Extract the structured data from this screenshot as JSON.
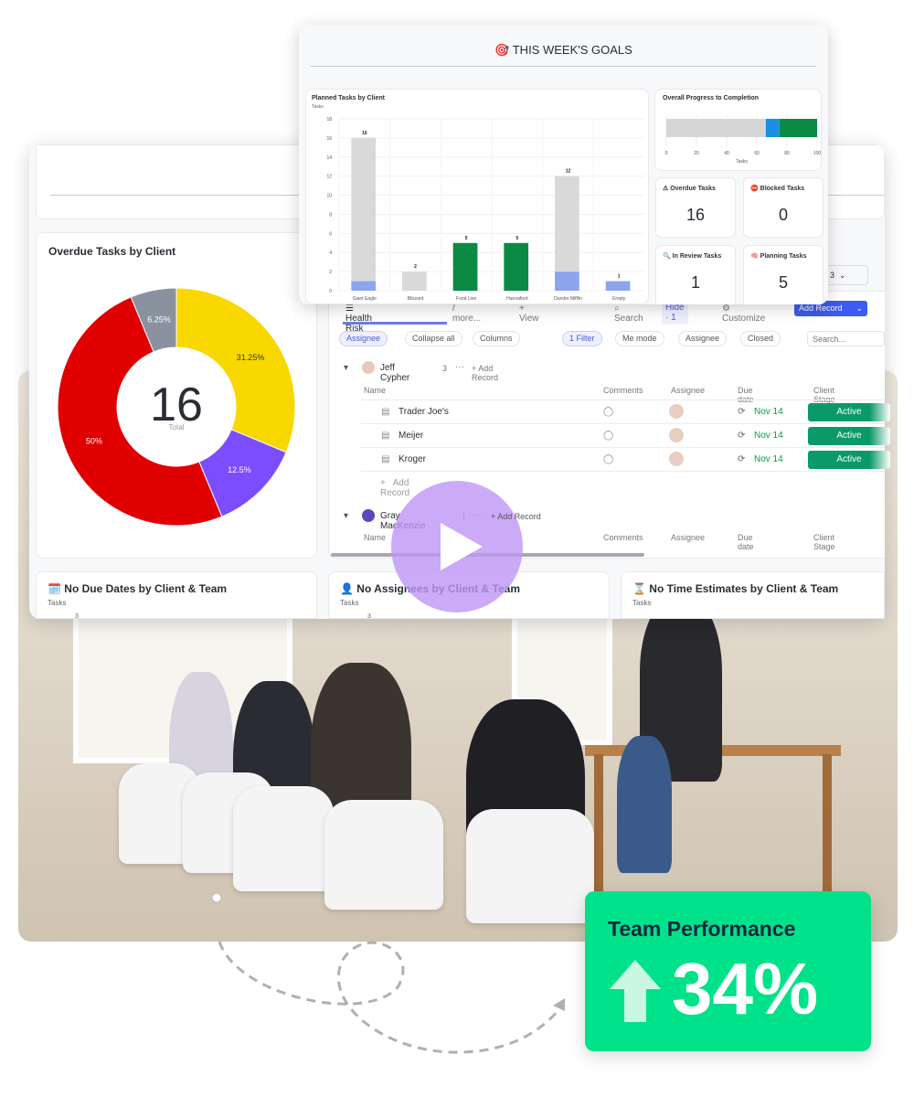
{
  "goals": {
    "title": "🎯 THIS WEEK'S GOALS",
    "bar_chart": {
      "title": "Planned Tasks by Client",
      "ylabel": "Tasks"
    },
    "progress": {
      "title": "Overall Progress to Completion",
      "xlabel": "Tasks"
    },
    "kpis": [
      {
        "label": "⚠ Overdue Tasks",
        "value": "16"
      },
      {
        "label": "⛔ Blocked Tasks",
        "value": "0"
      },
      {
        "label": "🔍 In Review Tasks",
        "value": "1"
      },
      {
        "label": "🧠 Planning Tasks",
        "value": "5"
      }
    ]
  },
  "chart_data": [
    {
      "type": "bar",
      "stacked": true,
      "title": "Planned Tasks by Client",
      "ylabel": "Tasks",
      "ylim": [
        0,
        18
      ],
      "yticks": [
        0,
        2,
        4,
        6,
        8,
        10,
        12,
        14,
        16,
        18
      ],
      "grid": true,
      "categories": [
        "Giant Eagle",
        "Blizzard",
        "Food Lion",
        "Hannaford",
        "Dunder Mifflin",
        "Empty"
      ],
      "totals": [
        "16",
        "2",
        "5",
        "5",
        "12",
        "1"
      ],
      "series": [
        {
          "color": "#8fa4ee",
          "values": [
            1,
            0,
            0,
            0,
            2,
            1
          ]
        },
        {
          "color": "#0a8a45",
          "values": [
            0,
            0,
            5,
            5,
            0,
            0
          ]
        },
        {
          "color": "#d9d9d9",
          "values": [
            15,
            2,
            0,
            0,
            10,
            0
          ]
        }
      ]
    },
    {
      "type": "bar",
      "orientation": "horizontal",
      "stacked": true,
      "title": "Overall Progress to Completion",
      "xlabel": "Tasks",
      "xlim": [
        0,
        100
      ],
      "xticks": [
        "0",
        "20",
        "40",
        "60",
        "80",
        "100"
      ],
      "series": [
        {
          "color": "#d6d6d6",
          "values": [
            66
          ]
        },
        {
          "color": "#1a8fe0",
          "values": [
            9
          ]
        },
        {
          "color": "#0a8a45",
          "values": [
            25
          ]
        }
      ]
    },
    {
      "type": "pie",
      "donut": true,
      "title": "Overdue Tasks by Client",
      "center_value": "16",
      "center_label": "Total",
      "slices": [
        {
          "label": "31.25%",
          "value": 31.25,
          "color": "#f8d800"
        },
        {
          "label": "12.5%",
          "value": 12.5,
          "color": "#7c4dff"
        },
        {
          "label": "50%",
          "value": 50,
          "color": "#e00000"
        },
        {
          "label": "6.25%",
          "value": 6.25,
          "color": "#8a92a0"
        }
      ]
    }
  ],
  "donut": {
    "title": "Overdue Tasks by Client",
    "center_value": "16",
    "center_label": "Total"
  },
  "toolbar": {
    "view_tab": "Health Risk Clients",
    "more": "/ more...",
    "add_view": "+ View",
    "search": "Search",
    "hide": "Hide · 1",
    "customize": "Customize",
    "add_record": "Add Record",
    "count": "3"
  },
  "filters": {
    "assignee": "Assignee",
    "collapse": "Collapse all",
    "columns": "Columns",
    "filter": "1 Filter",
    "me_mode": "Me mode",
    "assignee2": "Assignee",
    "closed": "Closed",
    "search_placeholder": "Search..."
  },
  "columns": [
    "Name",
    "Comments",
    "Assignee",
    "Due date",
    "Client Stage"
  ],
  "groups": [
    {
      "name": "Jeff Cypher",
      "count": "3",
      "add": "+ Add Record",
      "rows": [
        {
          "name": "Trader Joe's",
          "due": "Nov 14",
          "stage": "Active"
        },
        {
          "name": "Meijer",
          "due": "Nov 14",
          "stage": "Active"
        },
        {
          "name": "Kroger",
          "due": "Nov 14",
          "stage": "Active"
        }
      ],
      "add_row": "Add Record"
    },
    {
      "name": "Gray MacKenzie",
      "count": "1",
      "add": "+ Add Record"
    }
  ],
  "bottom_cards": [
    {
      "title": "🗓️ No Due Dates by Client & Team",
      "sub": "Tasks",
      "tick": "3"
    },
    {
      "title": "👤 No Assignees by Client & Team",
      "sub": "Tasks",
      "tick": "3"
    },
    {
      "title": "⌛ No Time Estimates by Client & Team",
      "sub": "Tasks"
    }
  ],
  "performance": {
    "title": "Team Performance",
    "value": "34%",
    "color": "#00e28a"
  }
}
